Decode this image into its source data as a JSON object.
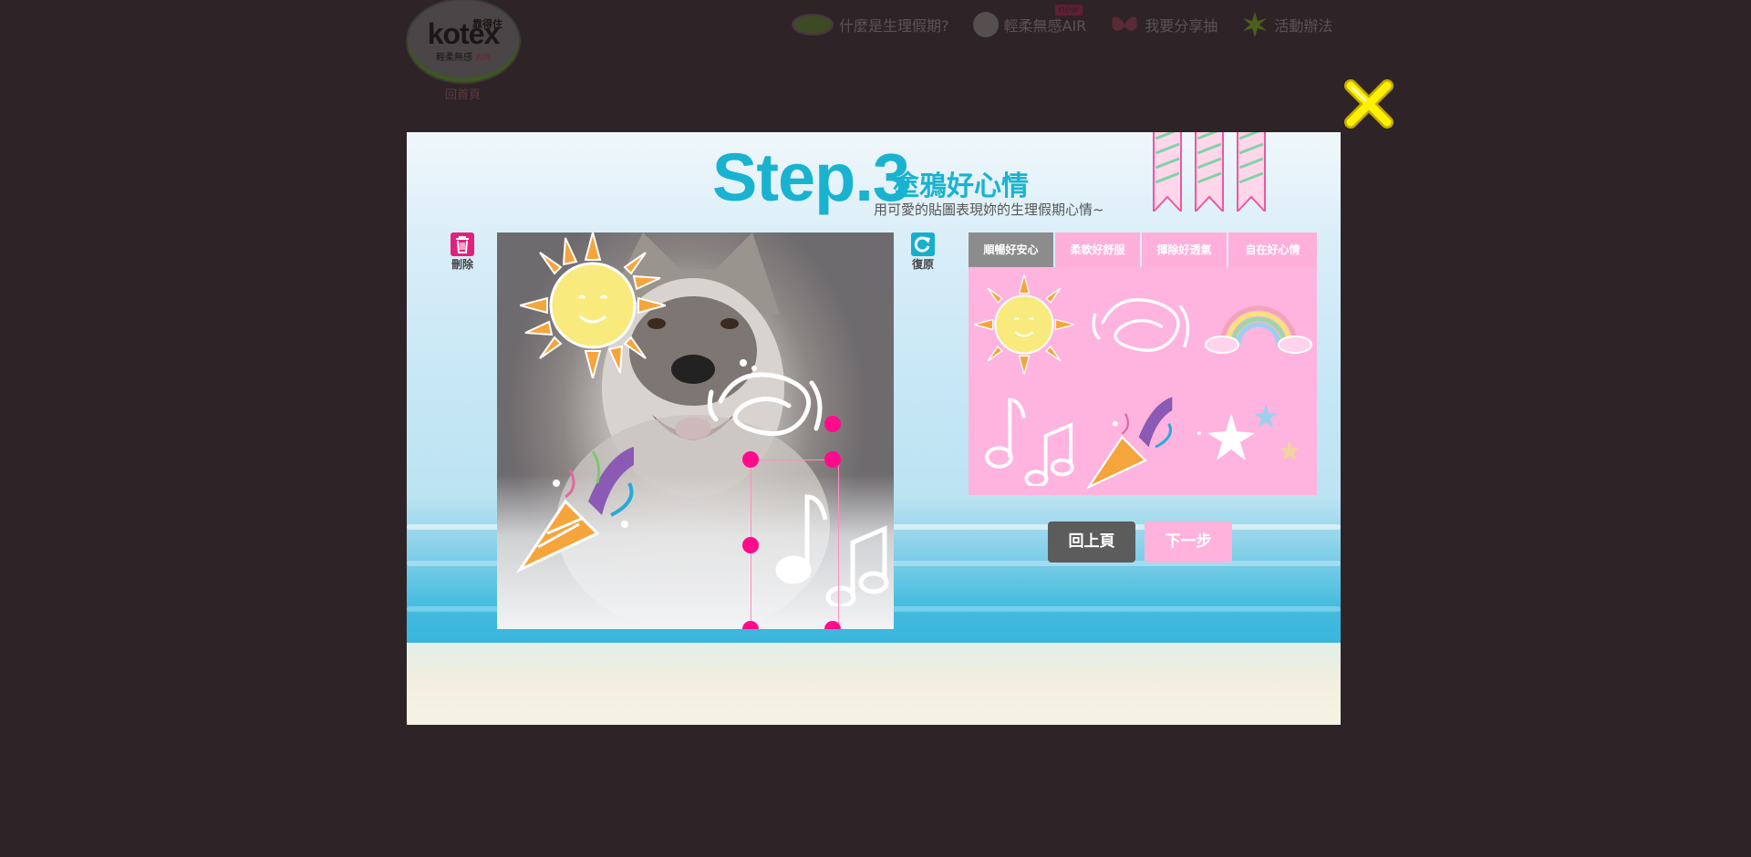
{
  "site": {
    "logo": {
      "brand": "kotex",
      "brand_cn": "靠得住",
      "sub": "輕柔無感",
      "sub_accent": "AIR"
    },
    "home_label": "回首頁",
    "nav": [
      {
        "label": "什麼是生理假期?",
        "icon": "ufo-hat-icon"
      },
      {
        "label": "輕柔無感AIR",
        "icon": "girl-face-icon",
        "badge": "new"
      },
      {
        "label": "我要分享抽",
        "icon": "butterfly-icon"
      },
      {
        "label": "活動辦法",
        "icon": "sparkle-burst-icon"
      }
    ]
  },
  "modal": {
    "title": "Step.3",
    "subtitle": "塗鴉好心情",
    "description": "用可愛的貼圖表現妳的生理假期心情~",
    "delete_label": "刪除",
    "restore_label": "復原",
    "tabs": [
      {
        "label": "順暢好安心",
        "active": true
      },
      {
        "label": "柔軟好舒服",
        "active": false
      },
      {
        "label": "揮除好透氣",
        "active": false
      },
      {
        "label": "自在好心情",
        "active": false
      }
    ],
    "stickers": [
      "sun-sticker",
      "swirl-sticker",
      "rainbow-sticker",
      "music-notes-sticker",
      "party-popper-sticker",
      "stars-sticker"
    ],
    "canvas_stickers": [
      "sun-sticker",
      "swirl-sticker",
      "party-popper-sticker",
      "music-notes-sticker"
    ],
    "back_label": "回上頁",
    "next_label": "下一步",
    "close_icon": "close-x-icon"
  },
  "colors": {
    "accent_blue": "#19b3d0",
    "accent_pink": "#ffb3df",
    "handle_pink": "#ff0b8b",
    "tab_active": "#8c8c8c",
    "close_yellow": "#fff200"
  }
}
